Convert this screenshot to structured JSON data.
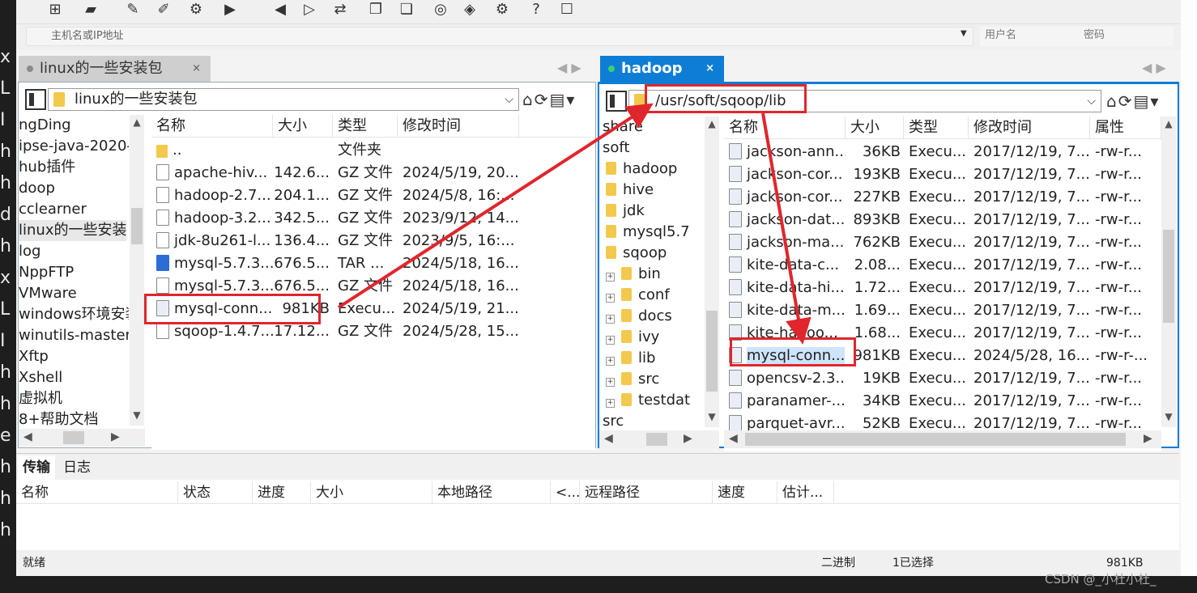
{
  "toolbar_icons": [
    "new-session-icon",
    "open-folder-icon",
    "disconnect-icon",
    "edit-icon",
    "properties-icon",
    "terminal-icon",
    "back-icon",
    "forward-icon",
    "sync-icon",
    "copy-icon",
    "paste-icon",
    "spiral-icon",
    "shield-icon",
    "gear-icon",
    "help-icon",
    "chat-icon"
  ],
  "address": {
    "host_placeholder": "主机名或IP地址",
    "user_placeholder": "用户名",
    "password_placeholder": "密码"
  },
  "left": {
    "tab_label": "linux的一些安装包",
    "path": "linux的一些安装包",
    "tree": [
      "ngDing",
      "ipse-java-2020-",
      "hub插件",
      "doop",
      "cclearner",
      "linux的一些安装",
      "log",
      "NppFTP",
      "VMware",
      "windows环境安装",
      "winutils-master",
      "Xftp",
      "Xshell",
      "虚拟机",
      "8+帮助文档"
    ],
    "columns": [
      "名称",
      "大小",
      "类型",
      "修改时间"
    ],
    "files": [
      {
        "name": "..",
        "size": "",
        "type": "文件夹",
        "modified": "",
        "icon": "folder-up-icon"
      },
      {
        "name": "apache-hiv...",
        "size": "142.6...",
        "type": "GZ 文件",
        "modified": "2024/5/19, 20...",
        "icon": "file-icon"
      },
      {
        "name": "hadoop-2.7...",
        "size": "204.1...",
        "type": "GZ 文件",
        "modified": "2024/5/8, 16:...",
        "icon": "file-icon"
      },
      {
        "name": "hadoop-3.2...",
        "size": "342.5...",
        "type": "GZ 文件",
        "modified": "2023/9/12, 14...",
        "icon": "file-icon"
      },
      {
        "name": "jdk-8u261-l...",
        "size": "136.4...",
        "type": "GZ 文件",
        "modified": "2023/9/5, 16:...",
        "icon": "file-icon"
      },
      {
        "name": "mysql-5.7.3...",
        "size": "676.5...",
        "type": "TAR ...",
        "modified": "2024/5/18, 16...",
        "icon": "archive-icon"
      },
      {
        "name": "mysql-5.7.3...",
        "size": "676.5...",
        "type": "GZ 文件",
        "modified": "2024/5/18, 16...",
        "icon": "file-icon"
      },
      {
        "name": "mysql-conn...",
        "size": "981KB",
        "type": "Execu...",
        "modified": "2024/5/19, 21...",
        "icon": "jar-icon"
      },
      {
        "name": "sqoop-1.4.7...",
        "size": "17.12...",
        "type": "GZ 文件",
        "modified": "2024/5/28, 15...",
        "icon": "file-icon"
      }
    ]
  },
  "right": {
    "tab_label": "hadoop",
    "path": "/usr/soft/sqoop/lib",
    "tree": [
      {
        "label": "share",
        "indent": 0,
        "expand": false,
        "folder": false
      },
      {
        "label": "soft",
        "indent": 0,
        "expand": false,
        "folder": false
      },
      {
        "label": "hadoop",
        "indent": 1,
        "expand": false,
        "folder": true
      },
      {
        "label": "hive",
        "indent": 1,
        "expand": false,
        "folder": true
      },
      {
        "label": "jdk",
        "indent": 1,
        "expand": false,
        "folder": true
      },
      {
        "label": "mysql5.7",
        "indent": 1,
        "expand": false,
        "folder": true
      },
      {
        "label": "sqoop",
        "indent": 1,
        "expand": false,
        "folder": true
      },
      {
        "label": "bin",
        "indent": 2,
        "expand": true,
        "folder": true
      },
      {
        "label": "conf",
        "indent": 2,
        "expand": true,
        "folder": true
      },
      {
        "label": "docs",
        "indent": 2,
        "expand": true,
        "folder": true
      },
      {
        "label": "ivy",
        "indent": 2,
        "expand": true,
        "folder": true
      },
      {
        "label": "lib",
        "indent": 2,
        "expand": true,
        "folder": true
      },
      {
        "label": "src",
        "indent": 2,
        "expand": true,
        "folder": true
      },
      {
        "label": "testdat",
        "indent": 2,
        "expand": true,
        "folder": true
      },
      {
        "label": "src",
        "indent": 0,
        "expand": false,
        "folder": false
      }
    ],
    "columns": [
      "名称",
      "大小",
      "类型",
      "修改时间",
      "属性"
    ],
    "files": [
      {
        "name": "jackson-ann...",
        "size": "36KB",
        "type": "Execu...",
        "modified": "2017/12/19, 7...",
        "attr": "-rw-r..."
      },
      {
        "name": "jackson-cor...",
        "size": "193KB",
        "type": "Execu...",
        "modified": "2017/12/19, 7...",
        "attr": "-rw-r..."
      },
      {
        "name": "jackson-cor...",
        "size": "227KB",
        "type": "Execu...",
        "modified": "2017/12/19, 7...",
        "attr": "-rw-r..."
      },
      {
        "name": "jackson-dat...",
        "size": "893KB",
        "type": "Execu...",
        "modified": "2017/12/19, 7...",
        "attr": "-rw-r..."
      },
      {
        "name": "jackson-ma...",
        "size": "762KB",
        "type": "Execu...",
        "modified": "2017/12/19, 7...",
        "attr": "-rw-r..."
      },
      {
        "name": "kite-data-c...",
        "size": "2.08...",
        "type": "Execu...",
        "modified": "2017/12/19, 7...",
        "attr": "-rw-r..."
      },
      {
        "name": "kite-data-hi...",
        "size": "1.72...",
        "type": "Execu...",
        "modified": "2017/12/19, 7...",
        "attr": "-rw-r..."
      },
      {
        "name": "kite-data-m...",
        "size": "1.69...",
        "type": "Execu...",
        "modified": "2017/12/19, 7...",
        "attr": "-rw-r..."
      },
      {
        "name": "kite-hadoo...",
        "size": "1.68...",
        "type": "Execu...",
        "modified": "2017/12/19, 7...",
        "attr": "-rw-r..."
      },
      {
        "name": "mysql-conn...",
        "size": "981KB",
        "type": "Execu...",
        "modified": "2024/5/28, 16...",
        "attr": "-rw-r-..."
      },
      {
        "name": "opencsv-2.3...",
        "size": "19KB",
        "type": "Execu...",
        "modified": "2017/12/19, 7...",
        "attr": "-rw-r..."
      },
      {
        "name": "paranamer-...",
        "size": "34KB",
        "type": "Execu...",
        "modified": "2017/12/19, 7...",
        "attr": "-rw-r..."
      },
      {
        "name": "parquet-avr...",
        "size": "52KB",
        "type": "Execu...",
        "modified": "2017/12/19, 7...",
        "attr": "-rw-r..."
      }
    ]
  },
  "transfer": {
    "tab_transfer": "传输",
    "tab_log": "日志",
    "columns": [
      "名称",
      "状态",
      "进度",
      "大小",
      "本地路径",
      "<...",
      "远程路径",
      "速度",
      "估计..."
    ]
  },
  "status": {
    "ready": "就绪",
    "mode": "二进制",
    "selected": "1已选择",
    "size": "981KB"
  },
  "watermark": "CSDN @_小杜小杜_",
  "bg_terminal_chars": [
    "x",
    "L",
    "I",
    "h",
    "h",
    "d",
    "h",
    "x",
    "L",
    "I",
    "h",
    "h",
    "e",
    "h",
    "h",
    "h"
  ],
  "colors": {
    "accent": "#0e7dd6",
    "annotation": "#e0262c"
  }
}
